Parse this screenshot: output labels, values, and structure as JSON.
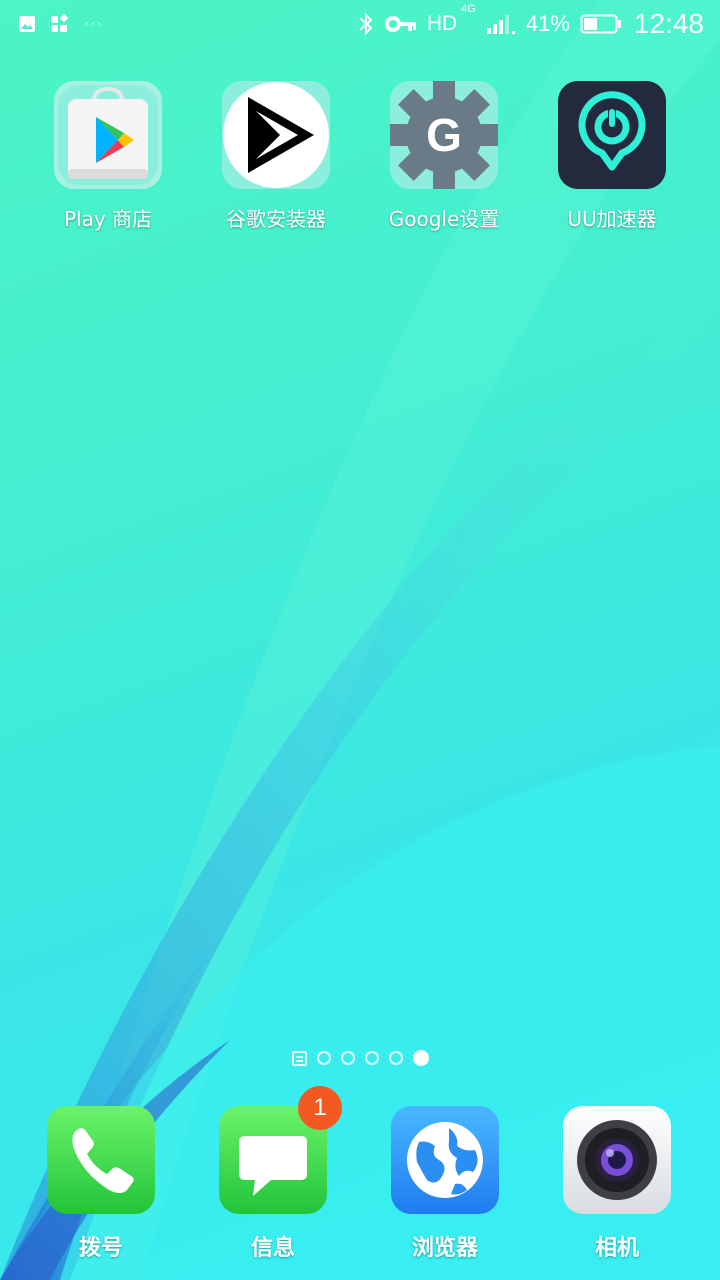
{
  "status_bar": {
    "left_icons": [
      "image-icon",
      "apps-widget-icon",
      "more-dots-icon"
    ],
    "dots_text": "···",
    "hd": "HD",
    "network": "4G",
    "battery_percent": "41%",
    "battery_level": 0.41,
    "time": "12:48"
  },
  "home_apps": [
    {
      "label": "Play 商店",
      "icon": "play-store-icon"
    },
    {
      "label": "谷歌安装器",
      "icon": "google-installer-icon"
    },
    {
      "label": "Google设置",
      "icon": "google-settings-icon"
    },
    {
      "label": "UU加速器",
      "icon": "uu-accelerator-icon"
    }
  ],
  "pager": {
    "pages": 5,
    "current_page": 5
  },
  "dock": [
    {
      "label": "拨号",
      "icon": "phone-icon"
    },
    {
      "label": "信息",
      "icon": "messages-icon",
      "badge": "1"
    },
    {
      "label": "浏览器",
      "icon": "browser-icon"
    },
    {
      "label": "相机",
      "icon": "camera-icon"
    }
  ]
}
